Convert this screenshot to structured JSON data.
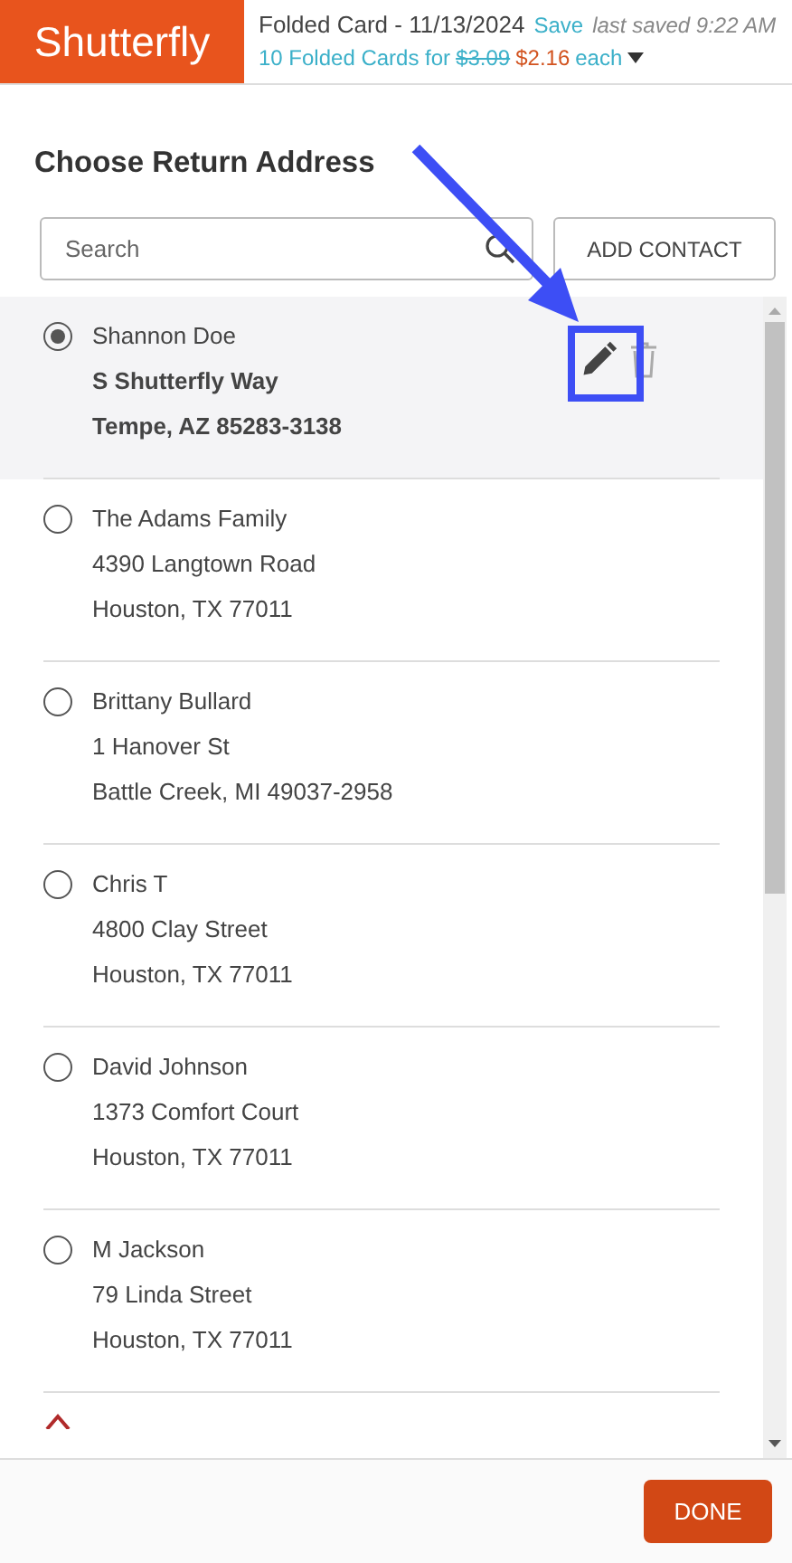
{
  "header": {
    "logo": "Shutterfly",
    "title": "Folded Card - 11/13/2024",
    "save": "Save",
    "saved_status": "last saved 9:22 AM",
    "offer": "10 Folded Cards for",
    "old_price": "$3.09",
    "new_price": "$2.16",
    "unit": "each"
  },
  "dialog": {
    "title": "Choose Return Address",
    "search": {
      "placeholder": "Search"
    },
    "add_button": "ADD CONTACT",
    "contacts": [
      {
        "name": "Shannon Doe",
        "street": "S Shutterfly Way",
        "city": "Tempe, AZ 85283-3138",
        "selected": true
      },
      {
        "name": "The Adams Family",
        "street": "4390 Langtown Road",
        "city": "Houston, TX 77011",
        "selected": false
      },
      {
        "name": "Brittany Bullard",
        "street": "1 Hanover St",
        "city": "Battle Creek, MI 49037-2958",
        "selected": false
      },
      {
        "name": "Chris T",
        "street": "4800 Clay Street",
        "city": "Houston, TX 77011",
        "selected": false
      },
      {
        "name": "David Johnson",
        "street": "1373 Comfort Court",
        "city": "Houston, TX 77011",
        "selected": false
      },
      {
        "name": "M Jackson",
        "street": "79 Linda Street",
        "city": "Houston, TX 77011",
        "selected": false
      }
    ],
    "done_button": "DONE"
  }
}
